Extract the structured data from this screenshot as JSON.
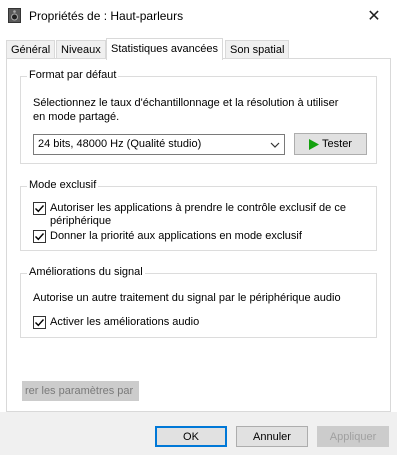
{
  "window": {
    "title": "Propriétés de : Haut-parleurs",
    "icon": "speaker-icon",
    "close_glyph": "✕"
  },
  "tabs": [
    {
      "label": "Général",
      "active": false
    },
    {
      "label": "Niveaux",
      "active": false
    },
    {
      "label": "Statistiques avancées",
      "active": true
    },
    {
      "label": "Son spatial",
      "active": false
    }
  ],
  "default_format": {
    "title": "Format par défaut",
    "description_line1": "Sélectionnez le taux d'échantillonnage et la résolution à utiliser",
    "description_line2": "en mode partagé.",
    "selected_value": "24 bits, 48000 Hz (Qualité studio)",
    "test_button": "Tester",
    "accent_color": "#13a10e"
  },
  "exclusive_mode": {
    "title": "Mode exclusif",
    "option1_line1": "Autoriser les applications à prendre le contrôle exclusif de ce",
    "option1_line2": "périphérique",
    "option1_checked": true,
    "option2": "Donner la priorité aux applications en mode exclusif",
    "option2_checked": true
  },
  "signal_enhancements": {
    "title": "Améliorations du signal",
    "description": "Autorise un autre traitement du signal par le périphérique audio",
    "option": "Activer les améliorations audio",
    "option_checked": true
  },
  "restore_button": "rer les paramètres par",
  "footer": {
    "ok": "OK",
    "cancel": "Annuler",
    "apply": "Appliquer",
    "primary_color": "#0078d7"
  }
}
